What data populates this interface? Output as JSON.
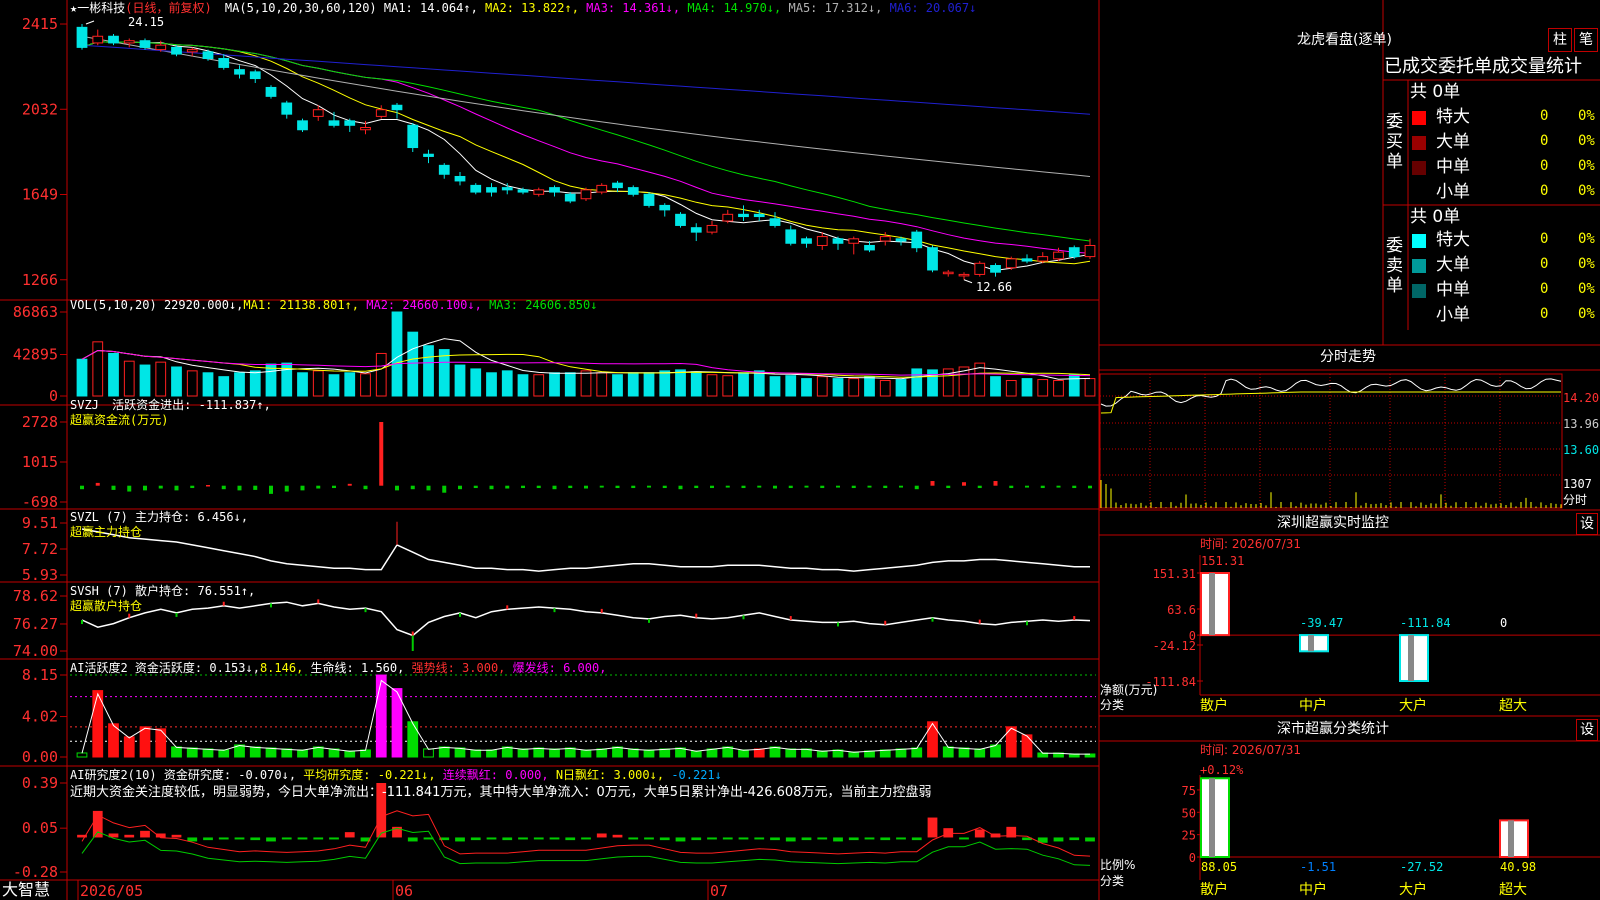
{
  "colors": {
    "up": "#ff2020",
    "down": "#00e6e6",
    "axis": "#c00000",
    "ma1": "#ffffff",
    "ma2": "#ffff00",
    "ma3": "#ff00ff",
    "ma4": "#00e000",
    "ma5": "#b0b0b0",
    "ma6": "#2020d0",
    "gain": "#ff2020",
    "loss": "#00cc00"
  },
  "main": {
    "title": "★一彬科技",
    "period": "(日线，前复权)",
    "ma_params": "MA(5,10,20,30,60,120)",
    "ma_values": [
      {
        "label": "MA1: 14.064↑,",
        "color": "#ffffff"
      },
      {
        "label": "MA2: 13.822↑,",
        "color": "#ffff00"
      },
      {
        "label": "MA3: 14.361↓,",
        "color": "#ff00ff"
      },
      {
        "label": "MA4: 14.970↓,",
        "color": "#00e000"
      },
      {
        "label": "MA5: 17.312↓,",
        "color": "#b0b0b0"
      },
      {
        "label": "MA6: 20.067↓",
        "color": "#2020d0"
      }
    ],
    "y_ticks": [
      "2415",
      "2032",
      "1649",
      "1266"
    ],
    "high_label": "24.15",
    "low_label": "12.66",
    "candles": [
      [
        24.0,
        23.1,
        24.15,
        23.0
      ],
      [
        23.3,
        23.6,
        23.9,
        23.2
      ],
      [
        23.6,
        23.3,
        23.7,
        23.2
      ],
      [
        23.3,
        23.4,
        23.5,
        23.1
      ],
      [
        23.4,
        23.1,
        23.5,
        23.0
      ],
      [
        23.0,
        23.2,
        23.4,
        22.9
      ],
      [
        23.1,
        22.8,
        23.2,
        22.7
      ],
      [
        22.9,
        23.0,
        23.1,
        22.7
      ],
      [
        22.9,
        22.6,
        23.0,
        22.5
      ],
      [
        22.6,
        22.2,
        22.8,
        22.1
      ],
      [
        22.1,
        21.9,
        22.3,
        21.7
      ],
      [
        22.0,
        21.7,
        22.1,
        21.5
      ],
      [
        21.3,
        20.9,
        21.4,
        20.8
      ],
      [
        20.6,
        20.1,
        20.7,
        19.9
      ],
      [
        19.8,
        19.4,
        19.9,
        19.3
      ],
      [
        20.0,
        20.3,
        20.5,
        19.8
      ],
      [
        19.8,
        19.6,
        20.2,
        19.5
      ],
      [
        19.8,
        19.6,
        19.9,
        19.3
      ],
      [
        19.4,
        19.5,
        19.8,
        19.2
      ],
      [
        20.0,
        20.3,
        20.5,
        19.9
      ],
      [
        20.5,
        20.3,
        20.6,
        19.9
      ],
      [
        19.6,
        18.6,
        19.7,
        18.4
      ],
      [
        18.3,
        18.2,
        18.5,
        17.9
      ],
      [
        17.8,
        17.4,
        17.9,
        17.2
      ],
      [
        17.3,
        17.1,
        17.5,
        16.9
      ],
      [
        16.9,
        16.6,
        17.0,
        16.5
      ],
      [
        16.8,
        16.6,
        17.0,
        16.4
      ],
      [
        16.8,
        16.7,
        17.0,
        16.5
      ],
      [
        16.7,
        16.6,
        16.8,
        16.5
      ],
      [
        16.5,
        16.7,
        16.8,
        16.4
      ],
      [
        16.8,
        16.6,
        16.9,
        16.4
      ],
      [
        16.5,
        16.2,
        16.6,
        16.1
      ],
      [
        16.3,
        16.7,
        16.8,
        16.2
      ],
      [
        16.6,
        16.9,
        17.0,
        16.5
      ],
      [
        17.0,
        16.8,
        17.1,
        16.6
      ],
      [
        16.8,
        16.5,
        16.9,
        16.4
      ],
      [
        16.5,
        16.0,
        16.6,
        15.9
      ],
      [
        16.0,
        15.8,
        16.1,
        15.5
      ],
      [
        15.6,
        15.1,
        15.7,
        15.0
      ],
      [
        15.0,
        14.8,
        15.2,
        14.4
      ],
      [
        14.8,
        15.1,
        15.3,
        14.7
      ],
      [
        15.3,
        15.6,
        15.8,
        15.2
      ],
      [
        15.6,
        15.5,
        16.0,
        15.3
      ],
      [
        15.6,
        15.5,
        15.8,
        15.3
      ],
      [
        15.4,
        15.1,
        15.7,
        15.0
      ],
      [
        14.9,
        14.3,
        15.1,
        14.2
      ],
      [
        14.5,
        14.3,
        14.6,
        14.1
      ],
      [
        14.2,
        14.6,
        14.8,
        14.0
      ],
      [
        14.5,
        14.3,
        14.6,
        14.0
      ],
      [
        14.3,
        14.5,
        14.6,
        13.8
      ],
      [
        14.2,
        14.0,
        14.4,
        13.9
      ],
      [
        14.4,
        14.6,
        14.8,
        14.2
      ],
      [
        14.5,
        14.4,
        14.6,
        14.2
      ],
      [
        14.8,
        14.1,
        14.9,
        13.9
      ],
      [
        14.1,
        13.1,
        14.2,
        13.0
      ],
      [
        13.0,
        13.0,
        13.1,
        12.8
      ],
      [
        12.9,
        12.9,
        13.0,
        12.66
      ],
      [
        12.9,
        13.4,
        13.5,
        12.8
      ],
      [
        13.3,
        13.0,
        13.4,
        12.8
      ],
      [
        13.2,
        13.6,
        13.7,
        13.1
      ],
      [
        13.6,
        13.5,
        13.8,
        13.4
      ],
      [
        13.5,
        13.7,
        13.9,
        13.4
      ],
      [
        13.6,
        13.9,
        14.1,
        13.5
      ],
      [
        14.1,
        13.7,
        14.2,
        13.6
      ],
      [
        13.7,
        14.2,
        14.5,
        13.6
      ]
    ]
  },
  "vol": {
    "label": "VOL(5,10,20)",
    "val": "22920.000↓,",
    "ma1": "MA1: 21138.801↑,",
    "ma2": "MA2: 24660.100↓,",
    "ma3": "MA3: 24606.850↓",
    "y_ticks": [
      "86863",
      "42895",
      "0"
    ],
    "values": [
      38000,
      56000,
      44000,
      36000,
      32000,
      35000,
      30000,
      26000,
      24000,
      20000,
      24000,
      26000,
      33000,
      34000,
      24000,
      26000,
      22000,
      24000,
      23000,
      44000,
      86863,
      66000,
      52000,
      48000,
      32000,
      28000,
      24000,
      26000,
      22000,
      22000,
      24000,
      24000,
      26000,
      24000,
      22000,
      24000,
      24000,
      26000,
      27000,
      25000,
      22000,
      21000,
      24000,
      26000,
      20000,
      21000,
      18000,
      20000,
      18000,
      18000,
      20000,
      16000,
      17000,
      28000,
      27000,
      28000,
      30000,
      34000,
      20000,
      16000,
      18000,
      17000,
      16000,
      22000,
      18000
    ]
  },
  "svzj": {
    "label": "SVZJ",
    "desc": "活跃资金进出: -111.837↑,",
    "sub": "超赢资金流(万元)",
    "y_ticks": [
      "2728",
      "1015",
      "-698"
    ],
    "values": [
      -150,
      120,
      -180,
      -250,
      -200,
      -120,
      -200,
      -100,
      30,
      -150,
      -200,
      -180,
      -350,
      -250,
      -200,
      -120,
      -100,
      80,
      -150,
      2728,
      -200,
      -150,
      -200,
      -300,
      -150,
      -100,
      -150,
      -120,
      -100,
      -100,
      -150,
      -100,
      -120,
      -80,
      -100,
      -100,
      -80,
      -100,
      -150,
      -100,
      -100,
      -80,
      -100,
      -80,
      -120,
      -100,
      -80,
      -100,
      -80,
      -100,
      -80,
      -100,
      -80,
      -150,
      200,
      -100,
      150,
      -100,
      200,
      -100,
      -80,
      -100,
      -80,
      -100,
      -112
    ]
  },
  "svzl": {
    "label": "SVZL (7)",
    "desc": "主力持仓: 6.456↓,",
    "sub": "超赢主力持仓",
    "y_ticks": [
      "9.51",
      "7.72",
      "5.93"
    ],
    "values": [
      9.1,
      8.9,
      8.7,
      8.5,
      8.4,
      8.3,
      8.2,
      8.0,
      7.8,
      7.6,
      7.4,
      7.2,
      6.9,
      6.7,
      6.6,
      6.5,
      6.4,
      6.4,
      6.3,
      6.3,
      8.0,
      7.5,
      7.0,
      6.8,
      6.6,
      6.4,
      6.4,
      6.3,
      6.3,
      6.2,
      6.3,
      6.4,
      6.4,
      6.5,
      6.6,
      6.7,
      6.7,
      6.6,
      6.5,
      6.5,
      6.5,
      6.6,
      6.6,
      6.6,
      6.5,
      6.4,
      6.4,
      6.3,
      6.3,
      6.2,
      6.3,
      6.4,
      6.5,
      6.6,
      6.8,
      6.9,
      6.9,
      7.0,
      7.0,
      6.9,
      6.8,
      6.7,
      6.6,
      6.5,
      6.5
    ]
  },
  "svsh": {
    "label": "SVSH (7)",
    "desc": "散户持仓: 76.551↑,",
    "sub": "超赢散户持仓",
    "y_ticks": [
      "78.62",
      "76.27",
      "74.00"
    ],
    "values": [
      76.6,
      76.0,
      76.3,
      76.8,
      77.2,
      77.5,
      77.2,
      77.5,
      77.6,
      77.8,
      77.6,
      77.8,
      78.0,
      78.1,
      77.8,
      78.0,
      77.7,
      77.5,
      77.6,
      77.3,
      75.8,
      75.3,
      76.4,
      76.9,
      77.2,
      76.8,
      77.3,
      77.5,
      77.6,
      77.7,
      77.6,
      77.5,
      77.3,
      77.2,
      77.0,
      76.8,
      76.7,
      76.9,
      77.0,
      76.8,
      76.7,
      76.8,
      77.0,
      77.2,
      76.9,
      76.6,
      76.5,
      76.4,
      76.4,
      76.5,
      76.3,
      76.2,
      76.4,
      76.6,
      76.8,
      76.6,
      76.5,
      76.3,
      76.2,
      76.4,
      76.5,
      76.6,
      76.5,
      76.6,
      76.55
    ]
  },
  "ai_hy": {
    "label": "AI活跃度2",
    "desc1": "资金活跃度: 0.153↓,",
    "desc2": "8.146,",
    "desc3": "生命线: 1.560,",
    "desc4": "强势线: 3.000,",
    "desc5": "爆发线: 6.000,",
    "y_ticks": [
      "8.15",
      "4.02",
      "0.00"
    ],
    "values": [
      0.4,
      6.6,
      3.3,
      2.0,
      3.0,
      2.8,
      1.0,
      0.9,
      0.8,
      0.7,
      1.2,
      1.0,
      0.9,
      0.8,
      0.7,
      1.0,
      0.8,
      0.6,
      0.7,
      8.146,
      6.8,
      3.5,
      0.8,
      1.0,
      0.9,
      0.7,
      0.7,
      1.0,
      0.8,
      0.9,
      0.8,
      0.9,
      0.7,
      0.8,
      1.0,
      0.8,
      0.7,
      0.8,
      0.9,
      0.6,
      0.8,
      1.0,
      0.7,
      0.8,
      1.0,
      0.8,
      0.8,
      0.6,
      0.7,
      0.5,
      0.6,
      0.7,
      0.8,
      0.9,
      3.5,
      1.0,
      0.9,
      0.8,
      1.2,
      3.0,
      2.2,
      0.4,
      0.4,
      0.3,
      0.3,
      0.15
    ],
    "colors": [
      "g",
      "r",
      "r",
      "r",
      "r",
      "r",
      "g",
      "g",
      "g",
      "g",
      "g",
      "g",
      "g",
      "g",
      "g",
      "g",
      "g",
      "g",
      "g",
      "m",
      "m",
      "g",
      "g",
      "g",
      "g",
      "g",
      "g",
      "g",
      "g",
      "g",
      "g",
      "g",
      "g",
      "g",
      "g",
      "g",
      "g",
      "g",
      "g",
      "g",
      "g",
      "g",
      "g",
      "r",
      "g",
      "g",
      "g",
      "g",
      "g",
      "g",
      "g",
      "g",
      "g",
      "g",
      "r",
      "g",
      "g",
      "g",
      "g",
      "r",
      "r",
      "g",
      "g",
      "g",
      "g",
      "g"
    ]
  },
  "ai_yj": {
    "label": "AI研究度2(10)",
    "desc1": "资金研究度: -0.070↓,",
    "desc2": "平均研究度: -0.221↓,",
    "desc3": "连续飘红: 0.000,",
    "desc4": "N日飘红: 3.000↓,",
    "desc5": "-0.221↓",
    "comment": "近期大资金关注度较低，明显弱势，今日大单净流出：-111.841万元，其中特大单净流入：0万元，大单5日累计净出-426.608万元，当前主力控盘弱",
    "y_ticks": [
      "0.39",
      "0.05",
      "-0.28"
    ],
    "values": [
      0.0,
      0.18,
      0.01,
      0.0,
      0.03,
      0.01,
      0.0,
      -0.05,
      -0.04,
      -0.02,
      -0.03,
      -0.04,
      -0.05,
      -0.03,
      -0.02,
      -0.03,
      -0.02,
      0.02,
      -0.05,
      0.39,
      0.06,
      -0.05,
      -0.03,
      -0.04,
      -0.05,
      -0.04,
      -0.03,
      -0.04,
      -0.03,
      -0.02,
      -0.03,
      -0.04,
      -0.03,
      0.01,
      0.0,
      -0.03,
      -0.03,
      -0.04,
      -0.05,
      -0.04,
      -0.03,
      -0.02,
      -0.03,
      -0.02,
      -0.04,
      -0.05,
      -0.04,
      -0.03,
      -0.05,
      -0.04,
      -0.03,
      -0.04,
      -0.03,
      -0.04,
      0.13,
      0.05,
      -0.03,
      0.04,
      0.01,
      0.06,
      -0.04,
      -0.06,
      -0.05,
      -0.04,
      -0.05,
      -0.07
    ]
  },
  "xaxis": {
    "brand": "大智慧",
    "labels": [
      "2026/05",
      "06",
      "07"
    ]
  },
  "right": {
    "lhkp_title": "龙虎看盘(逐单)",
    "tab_zhu": "柱",
    "tab_bi": "笔",
    "tab_stats": "已成交委托单成交量统计",
    "buy_side": "委买单",
    "sell_side": "委卖单",
    "buy_total": "共 0单",
    "sell_total": "共 0单",
    "buy_rows": [
      {
        "color": "#ff0000",
        "label": "特大",
        "count": "0",
        "pct": "0%"
      },
      {
        "color": "#990000",
        "label": "大单",
        "count": "0",
        "pct": "0%"
      },
      {
        "color": "#660000",
        "label": "中单",
        "count": "0",
        "pct": "0%"
      },
      {
        "color": "",
        "label": "小单",
        "count": "0",
        "pct": "0%"
      }
    ],
    "sell_rows": [
      {
        "color": "#00ffff",
        "label": "特大",
        "count": "0",
        "pct": "0%"
      },
      {
        "color": "#009999",
        "label": "大单",
        "count": "0",
        "pct": "0%"
      },
      {
        "color": "#006666",
        "label": "中单",
        "count": "0",
        "pct": "0%"
      },
      {
        "color": "",
        "label": "小单",
        "count": "0",
        "pct": "0%"
      }
    ],
    "fs_title": "分时走势",
    "fs_ticks": [
      "14.20",
      "13.96",
      "13.60"
    ],
    "fs_vol_tick": "1307",
    "fs_vol_label": "分时",
    "sz_title": "深圳超赢实时监控",
    "sz_set": "设",
    "sz_time": "时间: 2026/07/31",
    "sz_ticks": [
      "151.31",
      "63.6",
      "0",
      "-24.12",
      "-111.84"
    ],
    "sz_values": [
      "151.31",
      "-39.47",
      "-111.84",
      "0"
    ],
    "sz_ylabel": "净额(万元)",
    "sz_cat_label": "分类",
    "sz_cats": [
      "散户",
      "中户",
      "大户",
      "超大"
    ],
    "sm_title": "深市超赢分类统计",
    "sm_set": "设",
    "sm_time": "时间: 2026/07/31",
    "sm_top": "+0.12%",
    "sm_ticks": [
      "75",
      "50",
      "25",
      "0"
    ],
    "sm_values": [
      "88.05",
      "-1.51",
      "-27.52",
      "40.98"
    ],
    "sm_ylabel": "比例%",
    "sm_cat_label": "分类",
    "sm_cats": [
      "散户",
      "中户",
      "大户",
      "超大"
    ]
  }
}
